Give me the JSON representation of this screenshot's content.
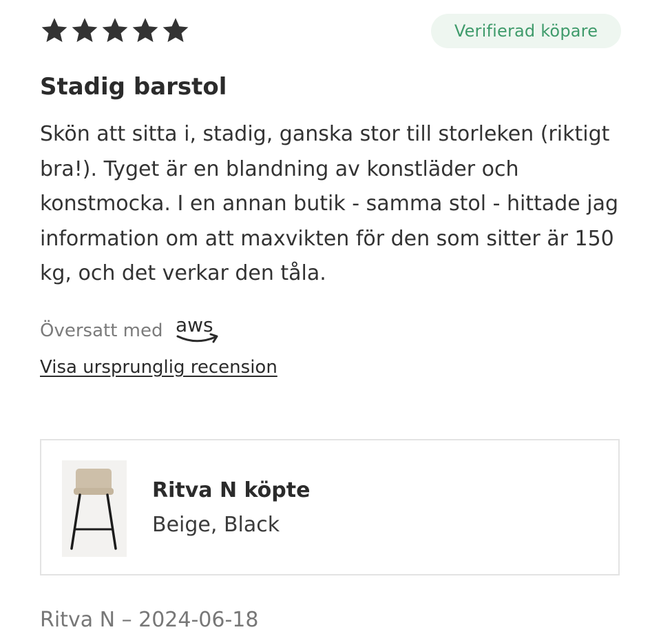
{
  "review": {
    "rating": 5,
    "max_rating": 5,
    "verified_badge": "Verifierad köpare",
    "title": "Stadig barstol",
    "body": "Skön att sitta i, stadig, ganska stor till storleken (riktigt bra!). Tyget är en blandning av konstläder och konstmocka. I en annan butik - samma stol - hittade jag information om att maxvikten för den som sitter är 150 kg, och det verkar den tåla.",
    "translated_label": "Översatt med",
    "translator_logo_text": "aws",
    "show_original_link": "Visa ursprunglig recension",
    "product": {
      "name": "Ritva N köpte",
      "variant": "Beige, Black",
      "thumbnail_icon": "bar-stool-image"
    },
    "author_date": "Ritva N – 2024-06-18"
  },
  "colors": {
    "star": "#333333",
    "badge_bg": "#eef6f0",
    "badge_text": "#3f9b6b",
    "muted_text": "#7b7b7b",
    "border": "#e3e3e3"
  }
}
